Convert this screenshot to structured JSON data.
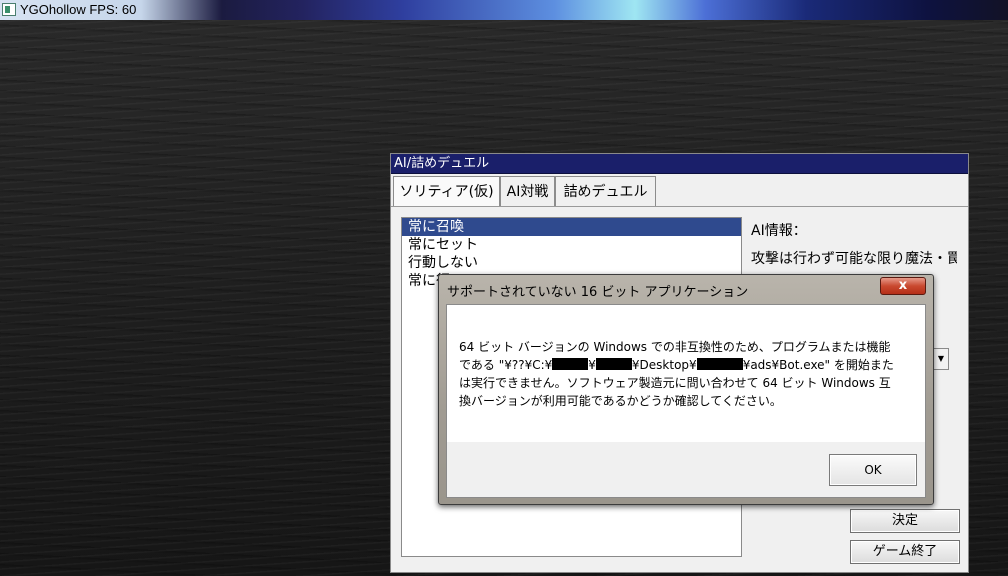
{
  "app": {
    "title_bar": "YGOhollow FPS: 60"
  },
  "window": {
    "title": "AI/詰めデュエル",
    "tabs": [
      {
        "label": "ソリティア(仮)",
        "active": true
      },
      {
        "label": "AI対戦",
        "active": false
      },
      {
        "label": "詰めデュエル",
        "active": false
      }
    ],
    "list_items": [
      {
        "label": "常に召喚",
        "selected": true
      },
      {
        "label": "常にセット",
        "selected": false
      },
      {
        "label": "行動しない",
        "selected": false
      },
      {
        "label": "常に行",
        "selected": false
      }
    ],
    "ai_info_label": "AI情報：",
    "ai_info_text": "攻撃は行わず可能な限り魔法・罠",
    "buttons": {
      "confirm": "決定",
      "quit": "ゲーム終了"
    }
  },
  "dialog": {
    "title": "サポートされていない 16 ビット アプリケーション",
    "close_glyph": "x",
    "message_part1": "64 ビット バージョンの Windows での非互換性のため、プログラムまたは機能\nである \"¥??¥C:¥",
    "message_sep1": "¥",
    "message_sep2": "¥Desktop¥",
    "message_part2": "¥ads¥Bot.exe\" を開始また\nは実行できません。ソフトウェア製造元に問い合わせて 64 ビット Windows 互\n換バージョンが利用可能であるかどうか確認してください。",
    "ok_label": "OK"
  }
}
